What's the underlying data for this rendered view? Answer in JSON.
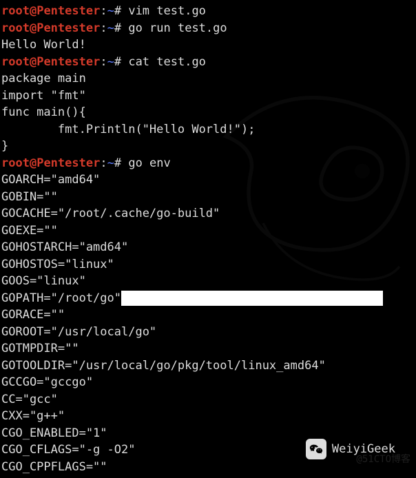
{
  "prompts": [
    {
      "user": "root",
      "host": "Pentester",
      "path": "~",
      "sym": "#",
      "cmd": "vim test.go"
    },
    {
      "user": "root",
      "host": "Pentester",
      "path": "~",
      "sym": "#",
      "cmd": "go run test.go"
    }
  ],
  "hello_output": "Hello World!",
  "cat_prompt": {
    "user": "root",
    "host": "Pentester",
    "path": "~",
    "sym": "#",
    "cmd": "cat test.go"
  },
  "go_source": [
    "package main",
    "import \"fmt\"",
    "func main(){",
    "        fmt.Println(\"Hello World!\");",
    "}"
  ],
  "env_prompt": {
    "user": "root",
    "host": "Pentester",
    "path": "~",
    "sym": "#",
    "cmd": "go env"
  },
  "env_before_highlight": [
    "GOARCH=\"amd64\"",
    "GOBIN=\"\"",
    "GOCACHE=\"/root/.cache/go-build\"",
    "GOEXE=\"\"",
    "GOHOSTARCH=\"amd64\"",
    "GOHOSTOS=\"linux\"",
    "GOOS=\"linux\""
  ],
  "gopath_line": "GOPATH=\"/root/go\"",
  "env_after_highlight": [
    "GORACE=\"\"",
    "GOROOT=\"/usr/local/go\"",
    "GOTMPDIR=\"\"",
    "GOTOOLDIR=\"/usr/local/go/pkg/tool/linux_amd64\"",
    "GCCGO=\"gccgo\"",
    "CC=\"gcc\"",
    "CXX=\"g++\"",
    "CGO_ENABLED=\"1\"",
    "CGO_CFLAGS=\"-g -O2\"",
    "CGO_CPPFLAGS=\"\""
  ],
  "watermark_main": "WeiyiGeek",
  "watermark_ghost": "@51CTO博客"
}
